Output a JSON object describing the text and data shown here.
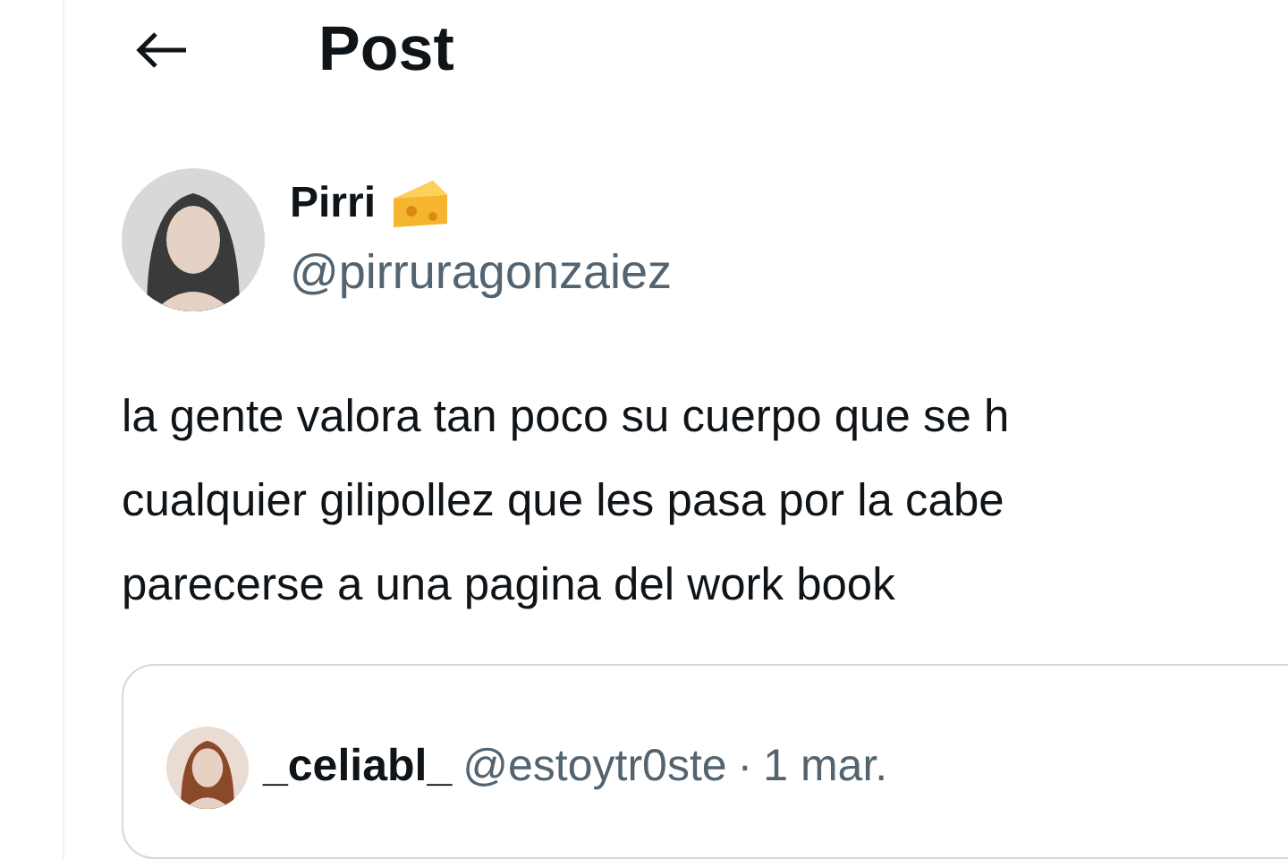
{
  "header": {
    "title": "Post"
  },
  "post": {
    "name": "Pirri",
    "handle": "@pirruragonzaiez",
    "lines": [
      "la gente valora tan poco su cuerpo que se h",
      "cualquier gilipollez que les pasa por la cabe",
      "parecerse a una pagina del work book"
    ]
  },
  "quote": {
    "name": "_celiabl_",
    "handle": "@estoytr0ste",
    "separator": "·",
    "date": "1 mar."
  }
}
